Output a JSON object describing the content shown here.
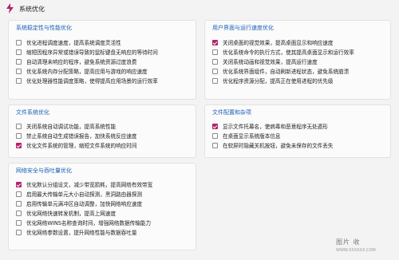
{
  "window": {
    "title": "系统优化"
  },
  "panels": {
    "system": {
      "title": "系统稳定性与性能优化",
      "options": [
        {
          "label": "优化进程调度速度，提高系统调度灵活性",
          "checked": false
        },
        {
          "label": "缩短因程序异常或错误导致的鼠标键盘无响应的等待时间",
          "checked": false
        },
        {
          "label": "自动清理未响应的程序，避免系统资源过度浪费",
          "checked": false
        },
        {
          "label": "优化系统内存分配策略，提高应用与游戏的响应速度",
          "checked": false
        },
        {
          "label": "优化处理器性能调度策略，使得提高应用场景的运行效率",
          "checked": false
        }
      ]
    },
    "ui": {
      "title": "用户界面与运行速度优化",
      "options": [
        {
          "label": "关闭桌面的视觉效果，提高桌面显示和响应速度",
          "checked": true
        },
        {
          "label": "优化系统命令的执行方式，使其提高桌面显示和运行效率",
          "checked": false
        },
        {
          "label": "关闭系统动画和视觉效果，提高运行速度",
          "checked": false
        },
        {
          "label": "优化系统界面组件，自动刷新进程状态，避免系统崩溃",
          "checked": false
        },
        {
          "label": "优化程序资源分配，提高正在使用进程的优先级",
          "checked": false
        }
      ]
    },
    "files": {
      "title": "文件系统优化",
      "options": [
        {
          "label": "关闭系统自动调试功能，提高系统性能",
          "checked": false
        },
        {
          "label": "禁止系统自动生成错误报告，加快系统反应速度",
          "checked": false
        },
        {
          "label": "优化文件系统的管理，缩短文件系统的响应时间",
          "checked": true
        }
      ]
    },
    "config": {
      "title": "文件配置和杂项",
      "options": [
        {
          "label": "显示文件托幕名，使病毒和恶意程序无处遁形",
          "checked": true
        },
        {
          "label": "在桌面显示系统版本信息",
          "checked": false
        },
        {
          "label": "在软屏时隐藏关机按钮，避免未保存的文件丢失",
          "checked": false
        }
      ]
    },
    "network": {
      "title": "网络安全与吞吐量优化",
      "options": [
        {
          "label": "优化默认分组设文，减少带宽损耗，提高网络有效带宽",
          "checked": true
        },
        {
          "label": "启用最大传输单元大小自动探测，黑洞路由器探测",
          "checked": false
        },
        {
          "label": "启用传输单元满冲区自动调整，加快网络响应速度",
          "checked": false
        },
        {
          "label": "优化网络快速转发机制，提高上网速度",
          "checked": false
        },
        {
          "label": "优化网络WINS名称查询时间，增强网络数据传输能力",
          "checked": false
        },
        {
          "label": "优化网络参数设置，提升网络性能与数据吞吐量",
          "checked": false
        }
      ]
    }
  },
  "colors": {
    "accent": "#b0236e",
    "section_title": "#1a5fb4",
    "icon": "#b0236e"
  },
  "watermark": {
    "text": "图片  收",
    "sub": "WWW.XXXXXX.COM"
  }
}
